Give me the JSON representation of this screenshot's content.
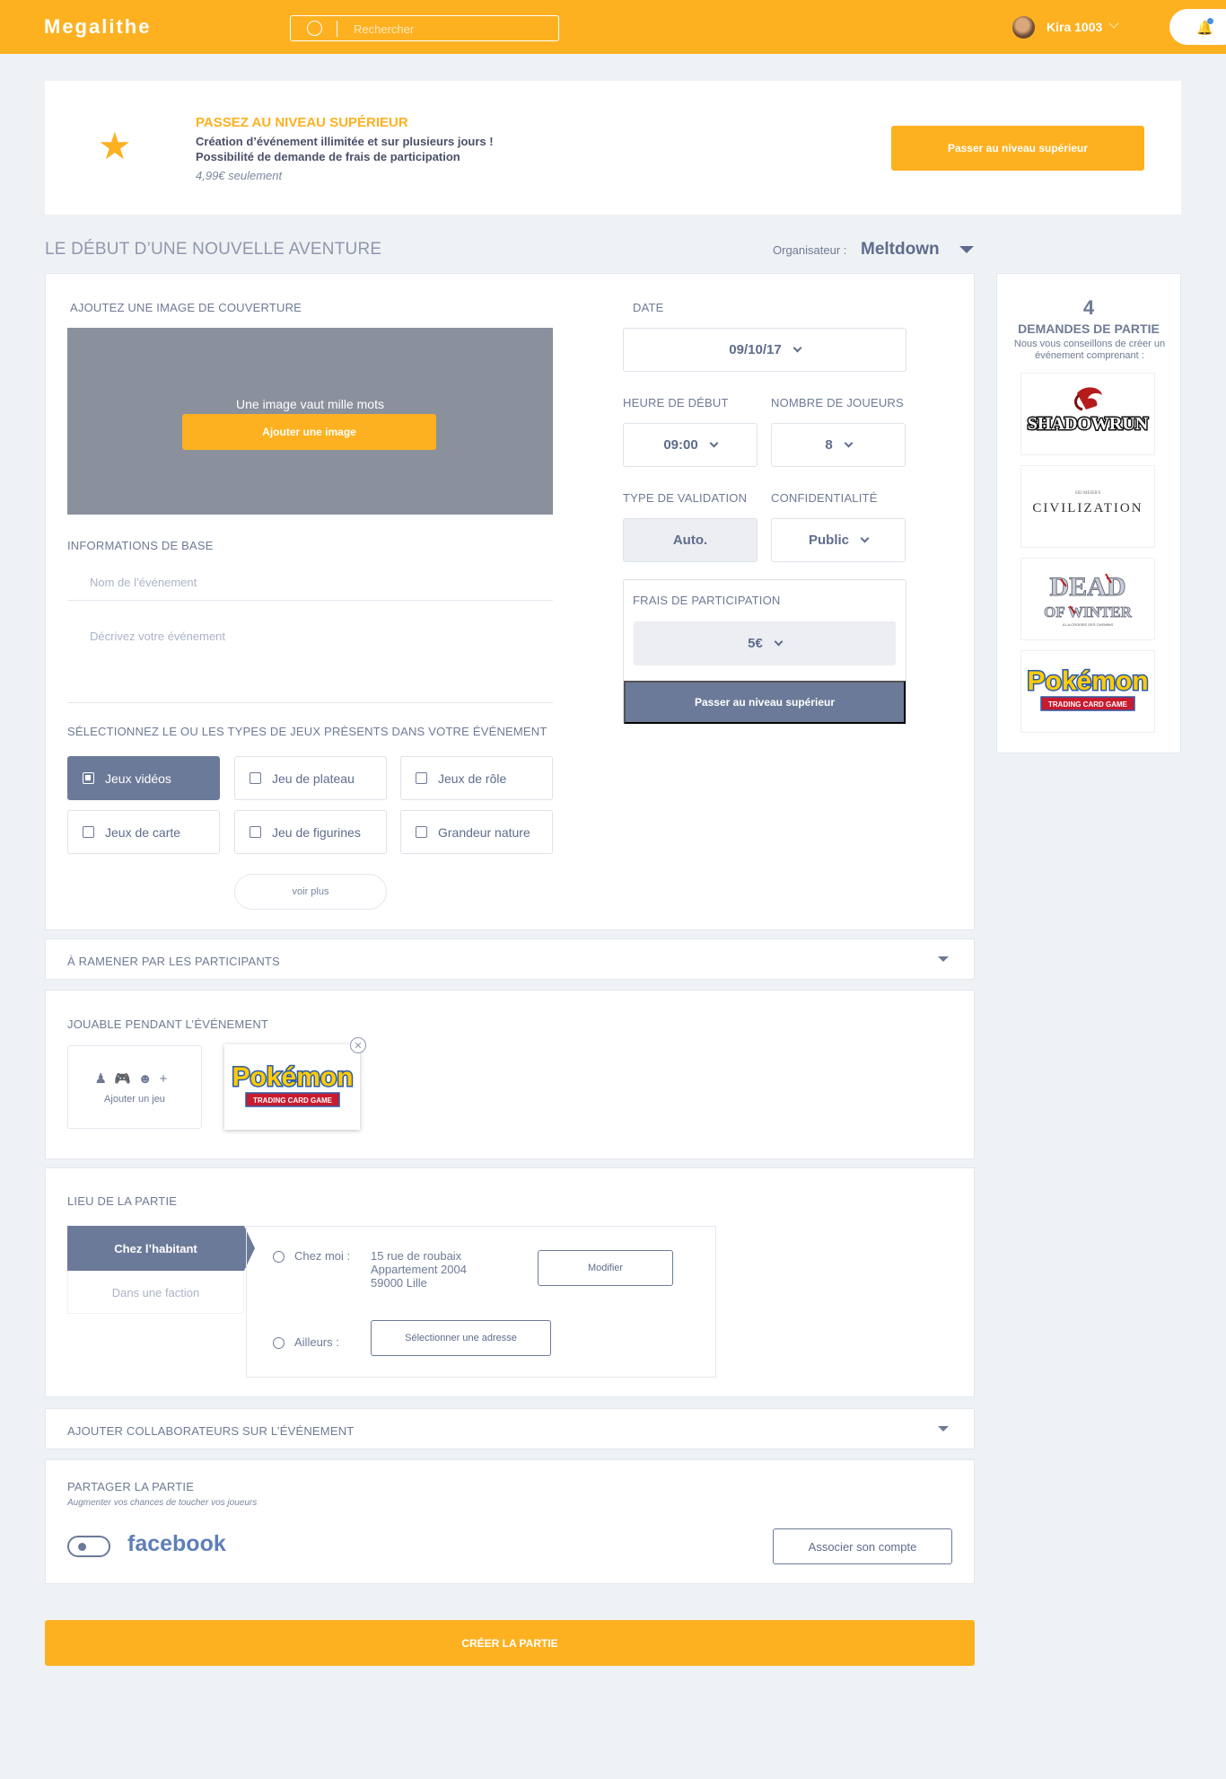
{
  "header": {
    "logo": "Megalithe",
    "search_placeholder": "Rechercher",
    "username": "Kira 1003"
  },
  "banner": {
    "title": "PASSEZ AU NIVEAU SUPÉRIEUR",
    "line1": "Création d’événement illimitée et sur plusieurs jours !",
    "line2": "Possibilité de demande de frais de participation",
    "price": "4,99€ seulement",
    "button": "Passer au niveau supérieur"
  },
  "page": {
    "title": "LE DÉBUT D’UNE NOUVELLE AVENTURE",
    "organizer_label": "Organisateur :",
    "organizer_name": "Meltdown"
  },
  "cover": {
    "label": "AJOUTEZ UNE IMAGE DE COUVERTURE",
    "text": "Une image vaut mille mots",
    "button": "Ajouter une image"
  },
  "basic_info": {
    "label": "INFORMATIONS DE BASE",
    "name_placeholder": "Nom de l’événement",
    "description_placeholder": "Décrivez votre événement"
  },
  "game_types": {
    "label": "SÉLECTIONNEZ LE OU LES TYPES DE JEUX PRÉSENTS DANS VOTRE ÉVÉNEMENT",
    "items": [
      {
        "label": "Jeux vidéos",
        "checked": true
      },
      {
        "label": "Jeu de plateau",
        "checked": false
      },
      {
        "label": "Jeux de rôle",
        "checked": false
      },
      {
        "label": "Jeux de carte",
        "checked": false
      },
      {
        "label": "Jeu de figurines",
        "checked": false
      },
      {
        "label": "Grandeur nature",
        "checked": false
      }
    ],
    "more": "voir plus"
  },
  "settings": {
    "date_label": "DATE",
    "date_value": "09/10/17",
    "start_label": "HEURE DE DÉBUT",
    "start_value": "09:00",
    "players_label": "NOMBRE DE JOUEURS",
    "players_value": "8",
    "validation_label": "TYPE DE VALIDATION",
    "validation_value": "Auto.",
    "privacy_label": "CONFIDENTIALITÉ",
    "privacy_value": "Public",
    "fee_label": "FRAIS DE PARTICIPATION",
    "fee_value": "5€",
    "fee_button": "Passer au niveau supérieur"
  },
  "requests": {
    "count": "4",
    "title": "DEMANDES DE PARTIE",
    "subtitle": "Nous vous conseillons de créer un événement comprenant :",
    "games": [
      "Shadowrun",
      "Civilization",
      "Dead of Winter",
      "Pokémon"
    ]
  },
  "bring": {
    "label": "À RAMENER PAR LES PARTICIPANTS"
  },
  "playable": {
    "label": "JOUABLE PENDANT L’ÉVÉNEMENT",
    "add_label": "Ajouter un jeu",
    "game": "Pokémon"
  },
  "location": {
    "label": "LIEU DE LA PARTIE",
    "tab_active": "Chez l’habitant",
    "tab_inactive": "Dans une faction",
    "home_label": "Chez moi :",
    "address_line1": "15 rue de roubaix",
    "address_line2": "Appartement 2004",
    "address_line3": "59000 Lille",
    "modify_button": "Modifier",
    "elsewhere_label": "Ailleurs :",
    "select_button": "Sélectionner une adresse"
  },
  "collaborators": {
    "label": "AJOUTER COLLABORATEURS SUR L’ÉVÉNEMENT"
  },
  "share": {
    "label": "PARTAGER LA PARTIE",
    "subtitle": "Augmenter vos chances de toucher vos joueurs",
    "network": "facebook",
    "button": "Associer son compte"
  },
  "create_button": "CRÉER LA PARTIE"
}
